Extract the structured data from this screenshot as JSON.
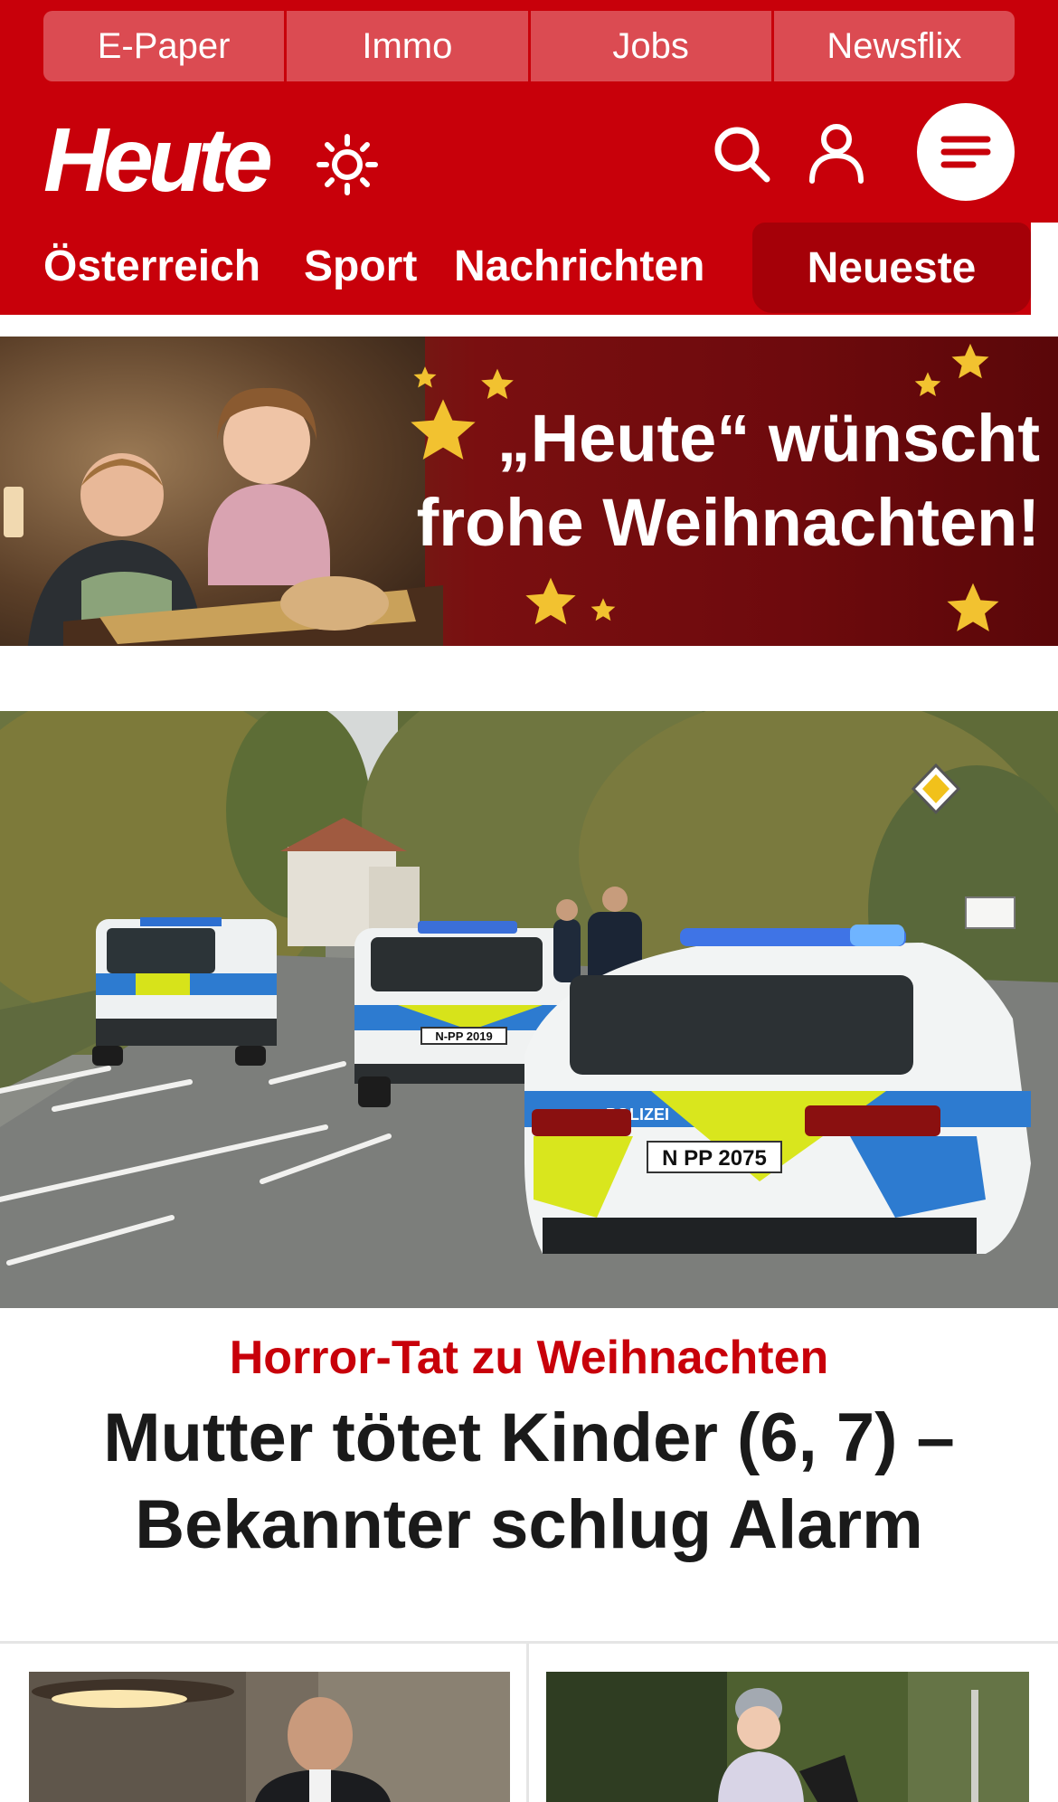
{
  "top_links": [
    "E-Paper",
    "Immo",
    "Jobs",
    "Newsflix"
  ],
  "brand": {
    "logo": "Heute",
    "primary_color": "#c8000a",
    "dark_red": "#a50008",
    "link_bg": "#db4b52"
  },
  "header_icons": [
    "sun-icon",
    "search-icon",
    "user-icon",
    "menu-icon"
  ],
  "nav": {
    "items": [
      "Österreich",
      "Sport",
      "Nachrichten"
    ],
    "highlight": "Neueste"
  },
  "banner": {
    "line1": "„Heute“ wünscht",
    "line2": "frohe Weihnachten!"
  },
  "hero": {
    "kicker": "Horror-Tat zu Weihnachten",
    "headline": "Mutter tötet Kinder (6, 7) – Bekannter schlug Alarm",
    "photo_plates": [
      "N-PP 2019",
      "N PP 2075"
    ],
    "photo_car_label": "POLIZEI"
  }
}
